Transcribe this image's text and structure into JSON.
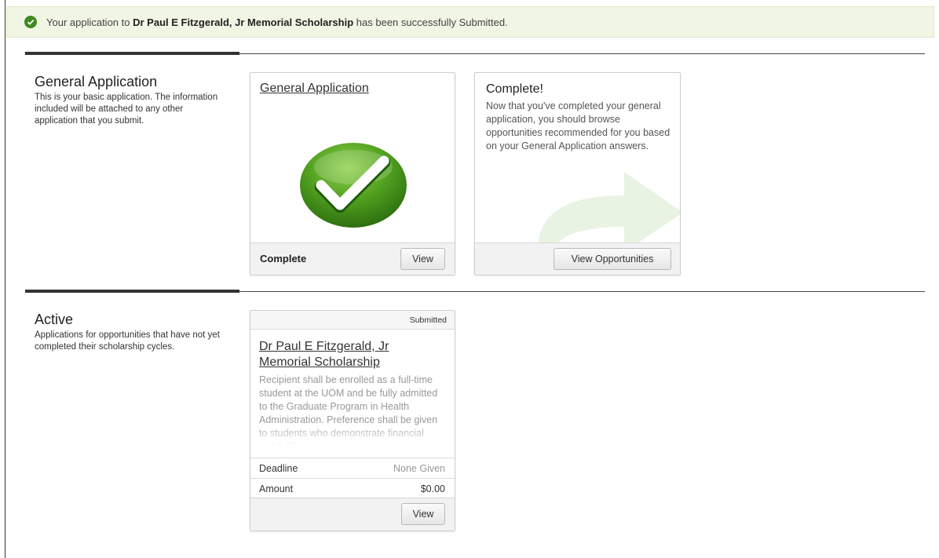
{
  "banner": {
    "prefix": "Your application to",
    "scholarship_name": "Dr Paul E Fitzgerald, Jr Memorial Scholarship",
    "suffix": "has been successfully Submitted."
  },
  "general_section": {
    "title": "General Application",
    "description": "This is your basic application. The information included will be attached to any other application that you submit."
  },
  "general_card": {
    "link": "General Application",
    "status": "Complete",
    "view_label": "View"
  },
  "complete_card": {
    "title": "Complete!",
    "description": "Now that you've completed your general application, you should browse opportunities recommended for you based on your General Application answers.",
    "button_label": "View Opportunities"
  },
  "active_section": {
    "title": "Active",
    "description": "Applications for opportunities that have not yet completed their scholarship cycles."
  },
  "scholarship_card": {
    "status_badge": "Submitted",
    "title": "Dr Paul E Fitzgerald, Jr Memorial Scholarship",
    "description": "Recipient shall be enrolled as a full-time student at the UOM and be fully admitted to the Graduate Program in Health Administration. Preference shall be given to students who demonstrate financial need. The",
    "deadline_label": "Deadline",
    "deadline_value": "None Given",
    "amount_label": "Amount",
    "amount_value": "$0.00",
    "view_label": "View"
  },
  "colors": {
    "banner_bg": "#f1f5e4",
    "success_green": "#3f8a1f",
    "arrow_green": "#e9f3e3"
  },
  "icons": [
    "check-circle-icon",
    "big-checkmark-icon",
    "curved-arrow-icon"
  ]
}
